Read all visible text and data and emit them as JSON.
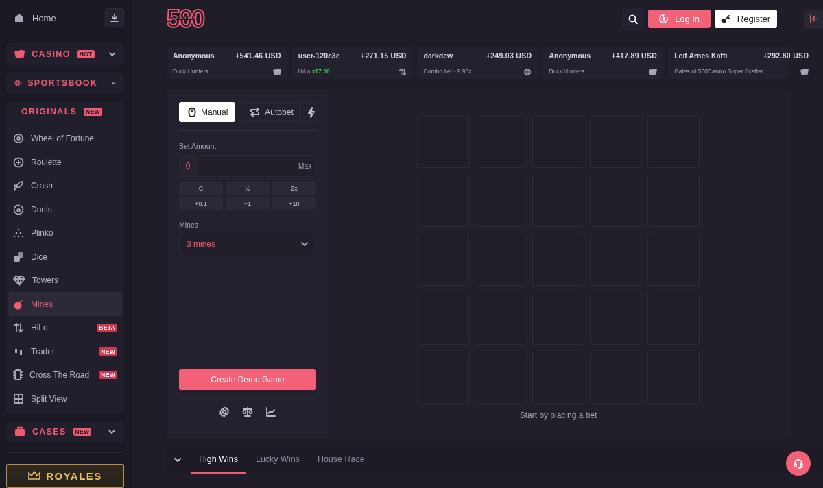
{
  "sidebar": {
    "home": {
      "label": "Home"
    },
    "sections": [
      {
        "label": "CASINO",
        "badge": "HOT",
        "expanded": false
      },
      {
        "label": "SPORTSBOOK",
        "expanded": false
      },
      {
        "label": "ORIGINALS",
        "badge": "NEW",
        "expanded": true,
        "items": [
          {
            "label": "Wheel of Fortune",
            "selected": false
          },
          {
            "label": "Roulette",
            "selected": false
          },
          {
            "label": "Crash",
            "selected": false
          },
          {
            "label": "Duels",
            "selected": false
          },
          {
            "label": "Plinko",
            "selected": false
          },
          {
            "label": "Dice",
            "selected": false
          },
          {
            "label": "Towers",
            "selected": false
          },
          {
            "label": "Mines",
            "selected": true
          },
          {
            "label": "HiLo",
            "badge": "BETA",
            "selected": false
          },
          {
            "label": "Trader",
            "badge": "NEW",
            "selected": false
          },
          {
            "label": "Cross The Road",
            "badge": "NEW",
            "selected": false
          },
          {
            "label": "Split View",
            "selected": false
          }
        ]
      },
      {
        "label": "CASES",
        "badge": "NEW",
        "expanded": false
      }
    ],
    "royales": "ROYALES"
  },
  "header": {
    "logo": {
      "main": "500",
      "sub": "CASINO"
    },
    "login": "Log In",
    "register": "Register"
  },
  "ticker": [
    {
      "user": "Anonymous",
      "amount": "+541.46 USD",
      "game": "Duck Hunters"
    },
    {
      "user": "user-120c3e",
      "amount": "+271.15 USD",
      "game": "HiLo",
      "multiplier": "x17.36"
    },
    {
      "user": "darkdew",
      "amount": "+249.03 USD",
      "game": "Combo bet - 9.96x"
    },
    {
      "user": "Anonymous",
      "amount": "+417.89 USD",
      "game": "Duck Hunters"
    },
    {
      "user": "Leif Arnes Kaffi",
      "amount": "+292.80 USD",
      "game": "Gates of 500Casino Super Scatter"
    }
  ],
  "bet_panel": {
    "tabs": [
      {
        "label": "Manual",
        "selected": true
      },
      {
        "label": "Autobet",
        "selected": false
      }
    ],
    "bet_amount": {
      "label": "Bet Amount",
      "value": "0",
      "max": "Max"
    },
    "quick_buttons": [
      "C",
      "½",
      "2x",
      "+0.1",
      "+1",
      "+10"
    ],
    "mines": {
      "label": "Mines",
      "value": "3 mines"
    },
    "create_button": "Create Demo Game"
  },
  "board": {
    "tiles": [
      {
        "kind": "hidden"
      },
      {
        "kind": "hidden"
      },
      {
        "kind": "hidden"
      },
      {
        "kind": "hidden"
      },
      {
        "kind": "hidden"
      },
      {
        "kind": "hidden"
      },
      {
        "kind": "hidden"
      },
      {
        "kind": "hidden"
      },
      {
        "kind": "hidden"
      },
      {
        "kind": "hidden"
      },
      {
        "kind": "hidden"
      },
      {
        "kind": "hidden"
      },
      {
        "kind": "hidden"
      },
      {
        "kind": "hidden"
      },
      {
        "kind": "hidden"
      },
      {
        "kind": "hidden"
      },
      {
        "kind": "hidden"
      },
      {
        "kind": "hidden"
      },
      {
        "kind": "hidden"
      },
      {
        "kind": "hidden"
      },
      {
        "kind": "hidden"
      },
      {
        "kind": "hidden"
      },
      {
        "kind": "hidden"
      },
      {
        "kind": "hidden"
      },
      {
        "kind": "hidden"
      }
    ],
    "message": "Start by placing a bet"
  },
  "wins_tabs": [
    {
      "label": "High Wins",
      "selected": true
    },
    {
      "label": "Lucky Wins",
      "selected": false
    },
    {
      "label": "House Race",
      "selected": false
    }
  ]
}
